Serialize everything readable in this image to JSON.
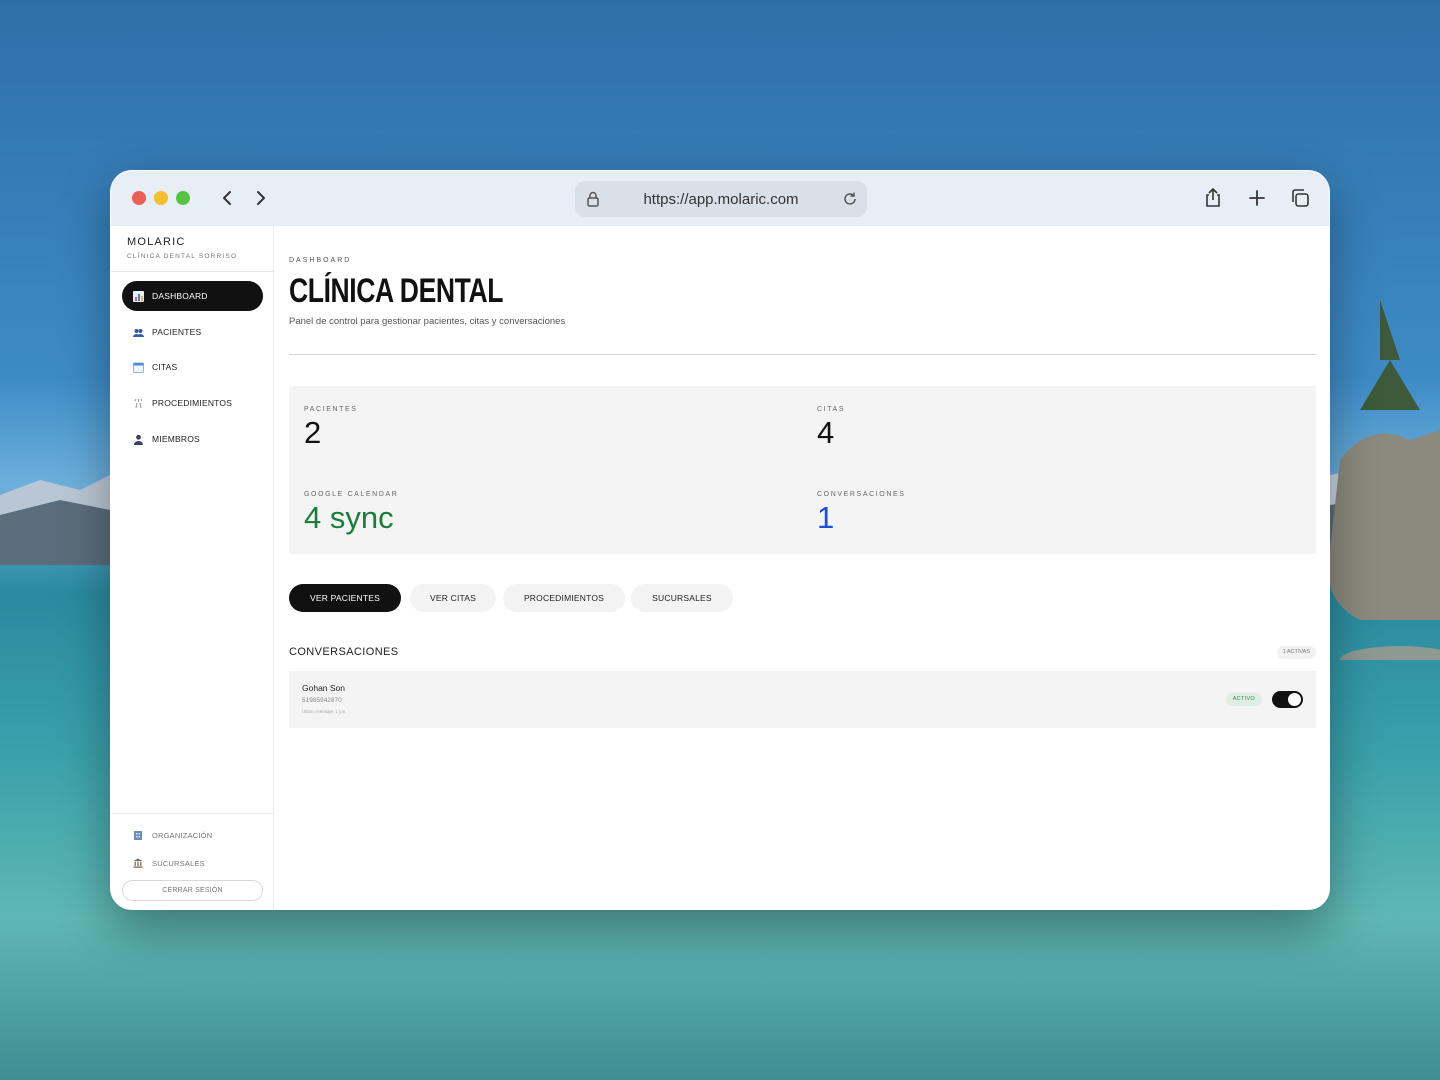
{
  "browser": {
    "url": "https://app.molaric.com"
  },
  "sidebar": {
    "brand": "MOLARIC",
    "subtitle": "CLÍNICA DENTAL SORRISO",
    "items": [
      {
        "label": "DASHBOARD",
        "icon": "chart-icon",
        "active": true
      },
      {
        "label": "PACIENTES",
        "icon": "users-icon"
      },
      {
        "label": "CITAS",
        "icon": "calendar-icon"
      },
      {
        "label": "PROCEDIMIENTOS",
        "icon": "tooth-icon"
      },
      {
        "label": "MIEMBROS",
        "icon": "user-icon"
      }
    ],
    "bottom": [
      {
        "label": "ORGANIZACIÓN",
        "icon": "building-icon"
      },
      {
        "label": "SUCURSALES",
        "icon": "bank-icon"
      }
    ],
    "logout": "CERRAR SESIÓN"
  },
  "header": {
    "breadcrumb": "DASHBOARD",
    "title": "CLÍNICA DENTAL",
    "description": "Panel de control para gestionar pacientes, citas y conversaciones"
  },
  "stats": [
    {
      "label": "PACIENTES",
      "value": "2"
    },
    {
      "label": "CITAS",
      "value": "4"
    },
    {
      "label": "GOOGLE CALENDAR",
      "value": "4 sync",
      "color": "#1b7d3a"
    },
    {
      "label": "CONVERSACIONES",
      "value": "1",
      "color": "#1d4fd6"
    }
  ],
  "actions": [
    "VER PACIENTES",
    "VER CITAS",
    "PROCEDIMIENTOS",
    "SUCURSALES"
  ],
  "conversations": {
    "title": "CONVERSACIONES",
    "badge": "1 ACTIVAS",
    "items": [
      {
        "name": "Gohan Son",
        "phone": "51985942870",
        "last": "Último mensaje: 1 jun",
        "status": "ACTIVO",
        "enabled": true
      }
    ]
  }
}
